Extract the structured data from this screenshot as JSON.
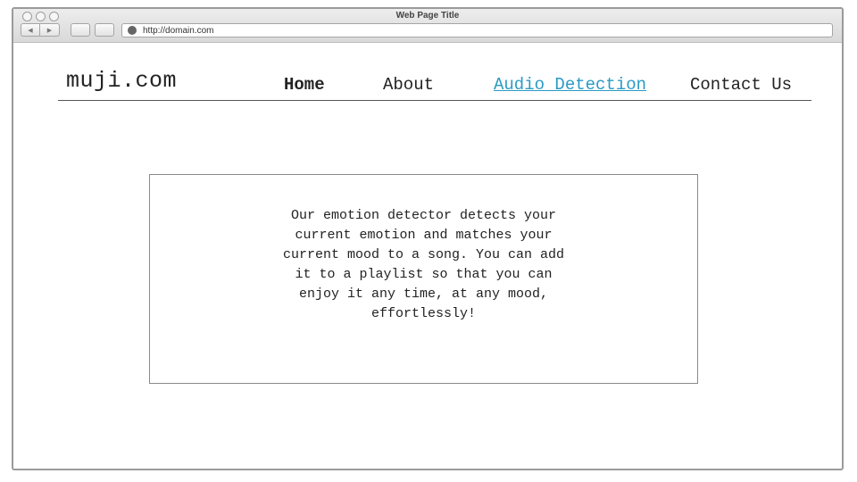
{
  "browser": {
    "window_title": "Web Page Title",
    "url": "http://domain.com",
    "back_icon": "◀",
    "forward_icon": "▶"
  },
  "site": {
    "logo": "muji.com",
    "nav": [
      {
        "label": "Home",
        "active": true
      },
      {
        "label": "About"
      },
      {
        "label": "Audio Detection",
        "link_color": "#2b9bc4"
      },
      {
        "label": "Contact Us"
      }
    ]
  },
  "main": {
    "description": "Our emotion detector detects your current emotion and matches your current mood to a song. You can add it to a playlist so that you can enjoy it any time, at any mood, effortlessly!"
  }
}
